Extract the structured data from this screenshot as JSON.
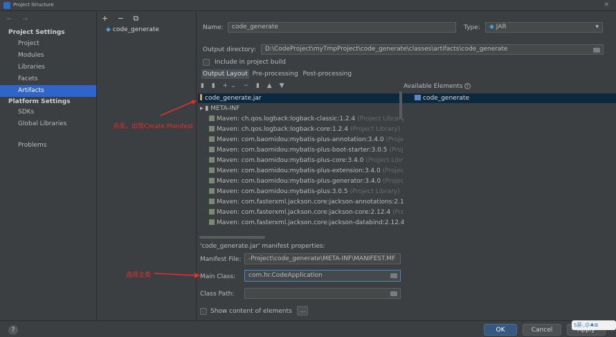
{
  "window": {
    "title": "Project Structure",
    "close": "×"
  },
  "nav": {
    "arrows": "← →"
  },
  "sidebar": {
    "project_settings": "Project Settings",
    "items_ps": [
      {
        "label": "Project"
      },
      {
        "label": "Modules"
      },
      {
        "label": "Libraries"
      },
      {
        "label": "Facets"
      },
      {
        "label": "Artifacts"
      }
    ],
    "platform_settings": "Platform Settings",
    "items_plat": [
      {
        "label": "SDKs"
      },
      {
        "label": "Global Libraries"
      }
    ],
    "problems": "Problems"
  },
  "artifacts_panel": {
    "tools": "+ − ⧉",
    "artifact": "code_generate"
  },
  "form": {
    "name_label": "Name:",
    "name_value": "code_generate",
    "type_label": "Type:",
    "type_value": "JAR",
    "output_label": "Output directory:",
    "output_value": "D:\\CodeProject\\myTmpProject\\code_generate\\classes\\artifacts\\code_generate",
    "include_label": "Include in project build",
    "tabs": [
      {
        "label": "Output Layout"
      },
      {
        "label": "Pre-processing"
      },
      {
        "label": "Post-processing"
      }
    ],
    "toolbar": "▮ ▮ +⌄ − ▮ ▲ ▼",
    "available_label": "Available Elements",
    "available_item": "code_generate"
  },
  "tree": [
    {
      "label": "code_generate.jar",
      "extra": ""
    },
    {
      "label": "▸ ▮ META-INF",
      "extra": ""
    },
    {
      "label": "Maven: ch.qos.logback:logback-classic:1.2.4",
      "extra": "(Project Library)"
    },
    {
      "label": "Maven: ch.qos.logback:logback-core:1.2.4",
      "extra": "(Project Library)"
    },
    {
      "label": "Maven: com.baomidou:mybatis-plus-annotation:3.4.0",
      "extra": "(Projec"
    },
    {
      "label": "Maven: com.baomidou:mybatis-plus-boot-starter:3.0.5",
      "extra": "(Proje"
    },
    {
      "label": "Maven: com.baomidou:mybatis-plus-core:3.4.0",
      "extra": "(Project Libra"
    },
    {
      "label": "Maven: com.baomidou:mybatis-plus-extension:3.4.0",
      "extra": "(Project"
    },
    {
      "label": "Maven: com.baomidou:mybatis-plus-generator:3.4.0",
      "extra": "(Project"
    },
    {
      "label": "Maven: com.baomidou:mybatis-plus:3.0.5",
      "extra": "(Project Library)"
    },
    {
      "label": "Maven: com.fasterxml.jackson.core:jackson-annotations:2.12",
      "extra": ""
    },
    {
      "label": "Maven: com.fasterxml.jackson.core:jackson-core:2.12.4",
      "extra": "(Proj"
    },
    {
      "label": "Maven: com.fasterxml.jackson.core:jackson-databind:2.12.4",
      "extra": "("
    }
  ],
  "manifest": {
    "heading": "'code_generate.jar' manifest properties:",
    "file_label": "Manifest File:",
    "file_value": "-Project\\code_generate\\META-INF\\MANIFEST.MF",
    "main_label": "Main Class:",
    "main_value": "com.hr.CodeApplication",
    "classpath_label": "Class Path:",
    "classpath_value": "",
    "show_label": "Show content of elements",
    "dots": "..."
  },
  "annotations": {
    "click_note": "点击，出现Create Manifest",
    "select_note": "选择主类"
  },
  "footer": {
    "help": "?",
    "ok": "OK",
    "cancel": "Cancel",
    "apply": "Apply"
  },
  "overlay": {
    "text": "S英·,☺♣⊞"
  }
}
